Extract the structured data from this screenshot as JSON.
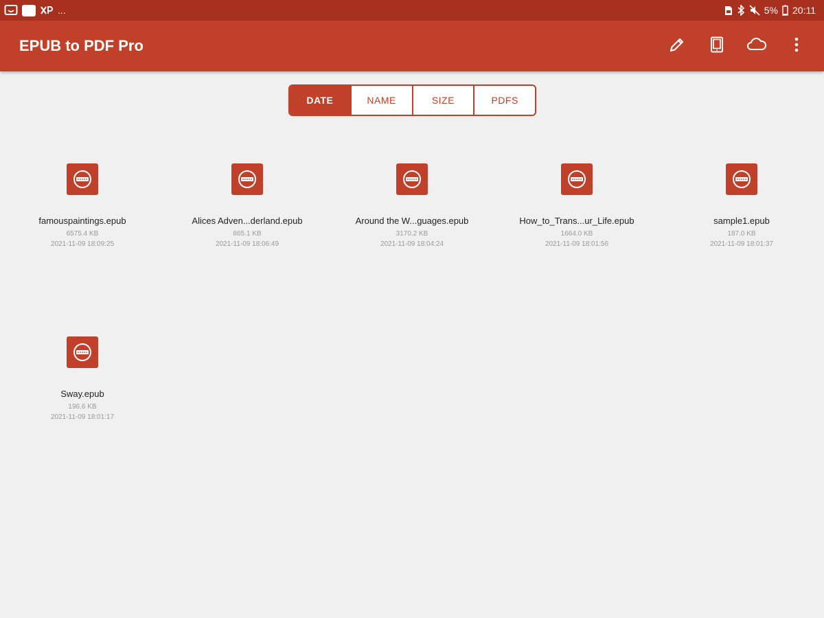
{
  "status_bar": {
    "left_text": "...",
    "battery": "5%",
    "time": "20:11"
  },
  "app_bar": {
    "title": "EPUB to PDF Pro",
    "actions": [
      "pencil-icon",
      "book-icon",
      "cloud-icon",
      "more-vert-icon"
    ]
  },
  "sort_tabs": [
    {
      "label": "DATE",
      "active": true
    },
    {
      "label": "NAME",
      "active": false
    },
    {
      "label": "SIZE",
      "active": false
    },
    {
      "label": "PDFS",
      "active": false
    }
  ],
  "files": [
    {
      "name": "famouspaintings.epub",
      "size": "6575.4 KB",
      "date": "2021-11-09 18:09:25"
    },
    {
      "name": "Alices Adven...derland.epub",
      "size": "865.1 KB",
      "date": "2021-11-09 18:06:49"
    },
    {
      "name": "Around the W...guages.epub",
      "size": "3170.2 KB",
      "date": "2021-11-09 18:04:24"
    },
    {
      "name": "How_to_Trans...ur_Life.epub",
      "size": "1664.0 KB",
      "date": "2021-11-09 18:01:56"
    },
    {
      "name": "sample1.epub",
      "size": "187.0 KB",
      "date": "2021-11-09 18:01:37"
    },
    {
      "name": "Sway.epub",
      "size": "196.6 KB",
      "date": "2021-11-09 18:01:17"
    }
  ],
  "colors": {
    "status_bar": "#a8301f",
    "app_bar": "#c0402a",
    "background": "#f0f0f0",
    "accent": "#c0402a"
  }
}
